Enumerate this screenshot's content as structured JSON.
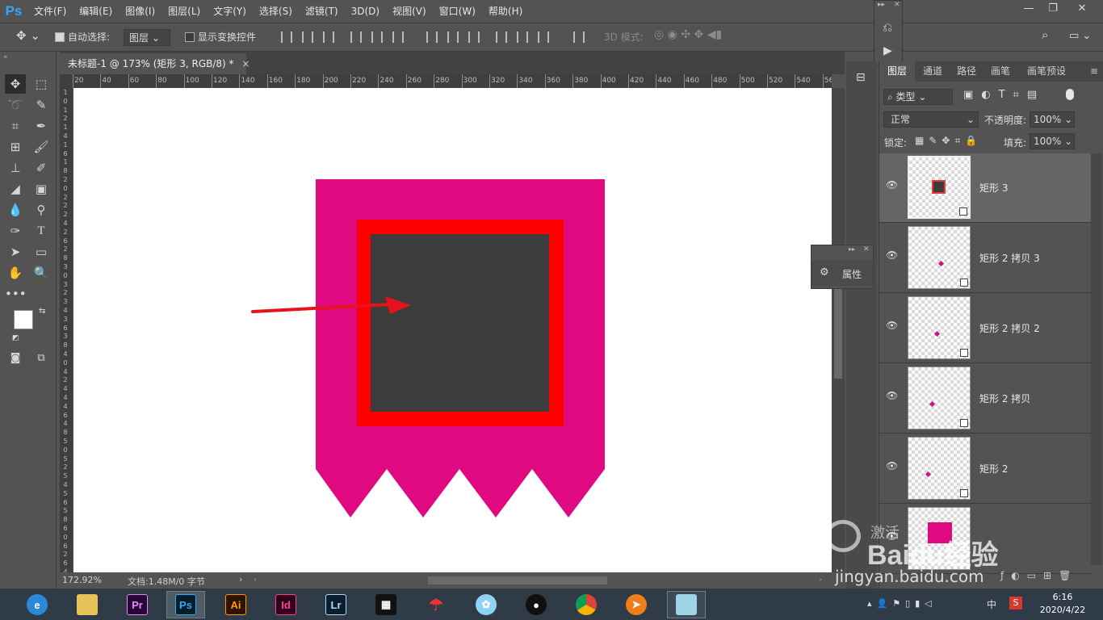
{
  "app": {
    "logo": "Ps"
  },
  "menu": [
    "文件(F)",
    "编辑(E)",
    "图像(I)",
    "图层(L)",
    "文字(Y)",
    "选择(S)",
    "滤镜(T)",
    "3D(D)",
    "视图(V)",
    "窗口(W)",
    "帮助(H)"
  ],
  "options": {
    "auto_select_label": "自动选择:",
    "auto_select_value": "图层",
    "show_transform_label": "显示变换控件",
    "mode_3d_label": "3D 模式:"
  },
  "document": {
    "tab_title": "未标题-1 @ 173% (矩形 3, RGB/8) *"
  },
  "ruler": {
    "top": [
      "20",
      "40",
      "60",
      "80",
      "100",
      "120",
      "140",
      "160",
      "180",
      "200",
      "220",
      "240",
      "260",
      "280",
      "300",
      "320",
      "340",
      "360",
      "380",
      "400",
      "420",
      "440",
      "460",
      "480",
      "500",
      "520",
      "540",
      "56"
    ],
    "left": [
      "1",
      "0",
      "1",
      "2",
      "1",
      "4",
      "1",
      "6",
      "1",
      "8",
      "2",
      "0",
      "2",
      "2",
      "2",
      "4",
      "2",
      "6",
      "2",
      "8",
      "3",
      "0",
      "3",
      "2",
      "3",
      "4",
      "3",
      "6",
      "3",
      "8",
      "4",
      "0",
      "4",
      "2",
      "4",
      "4",
      "4",
      "6",
      "4",
      "8",
      "5",
      "0",
      "5",
      "2",
      "5",
      "4",
      "5",
      "6",
      "5",
      "8",
      "6",
      "0",
      "6",
      "2",
      "6",
      "4"
    ]
  },
  "status": {
    "zoom": "172.92%",
    "doc_info": "文档:1.48M/0 字节"
  },
  "properties_panel": {
    "label": "属性"
  },
  "layers_panel": {
    "tabs": [
      "图层",
      "通道",
      "路径",
      "画笔",
      "画笔预设"
    ],
    "filter_kind": "类型",
    "blend_mode": "正常",
    "opacity_label": "不透明度:",
    "opacity_value": "100%",
    "lock_label": "锁定:",
    "fill_label": "填充:",
    "fill_value": "100%",
    "layers": [
      {
        "name": "矩形 3"
      },
      {
        "name": "矩形 2 拷贝 3"
      },
      {
        "name": "矩形 2 拷贝 2"
      },
      {
        "name": "矩形 2 拷贝"
      },
      {
        "name": "矩形 2"
      },
      {
        "name": ""
      }
    ]
  },
  "taskbar": {
    "apps": [
      "Pr",
      "Ps",
      "Ai",
      "Id",
      "Lr"
    ],
    "time": "6:16",
    "date": "2020/4/22",
    "tray_lang": "中"
  },
  "watermark": {
    "brand": "Baidu经验",
    "url": "jingyan.baidu.com",
    "overlay": "激活"
  },
  "colors": {
    "magenta": "#e0097f",
    "red": "#ff0000",
    "dark_gray": "#3c3c3c",
    "arrow": "#e3141b",
    "ps_blue": "#31a8ff"
  }
}
